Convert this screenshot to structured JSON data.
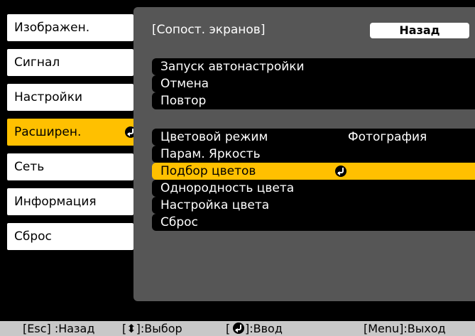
{
  "sidebar": {
    "items": [
      {
        "label": "Изображен."
      },
      {
        "label": "Сигнал"
      },
      {
        "label": "Настройки"
      },
      {
        "label": "Расширен."
      },
      {
        "label": "Сеть"
      },
      {
        "label": "Информация"
      },
      {
        "label": "Сброс"
      }
    ]
  },
  "panel": {
    "title": "[Сопост. экранов]",
    "back_label": "Назад",
    "group1": [
      "Запуск автонастройки",
      "Отмена",
      "Повтор"
    ],
    "group2": {
      "color_mode_label": "Цветовой режим",
      "color_mode_value": "Фотография",
      "brightness_label": "Парам. Яркость",
      "color_match_label": "Подбор цветов",
      "uniformity_label": "Однородность цвета",
      "color_adjust_label": "Настройка цвета",
      "reset_label": "Сброс"
    }
  },
  "footer": {
    "esc_hint": "[Esc] :Назад",
    "select_hint": "[⬍]:Выбор",
    "enter_bracket_open": "[",
    "enter_hint": "]:Ввод",
    "menu_hint": "[Menu]:Выход"
  },
  "colors": {
    "accent": "#ffc000",
    "panel_bg": "#565656",
    "row_bg": "#000000"
  }
}
